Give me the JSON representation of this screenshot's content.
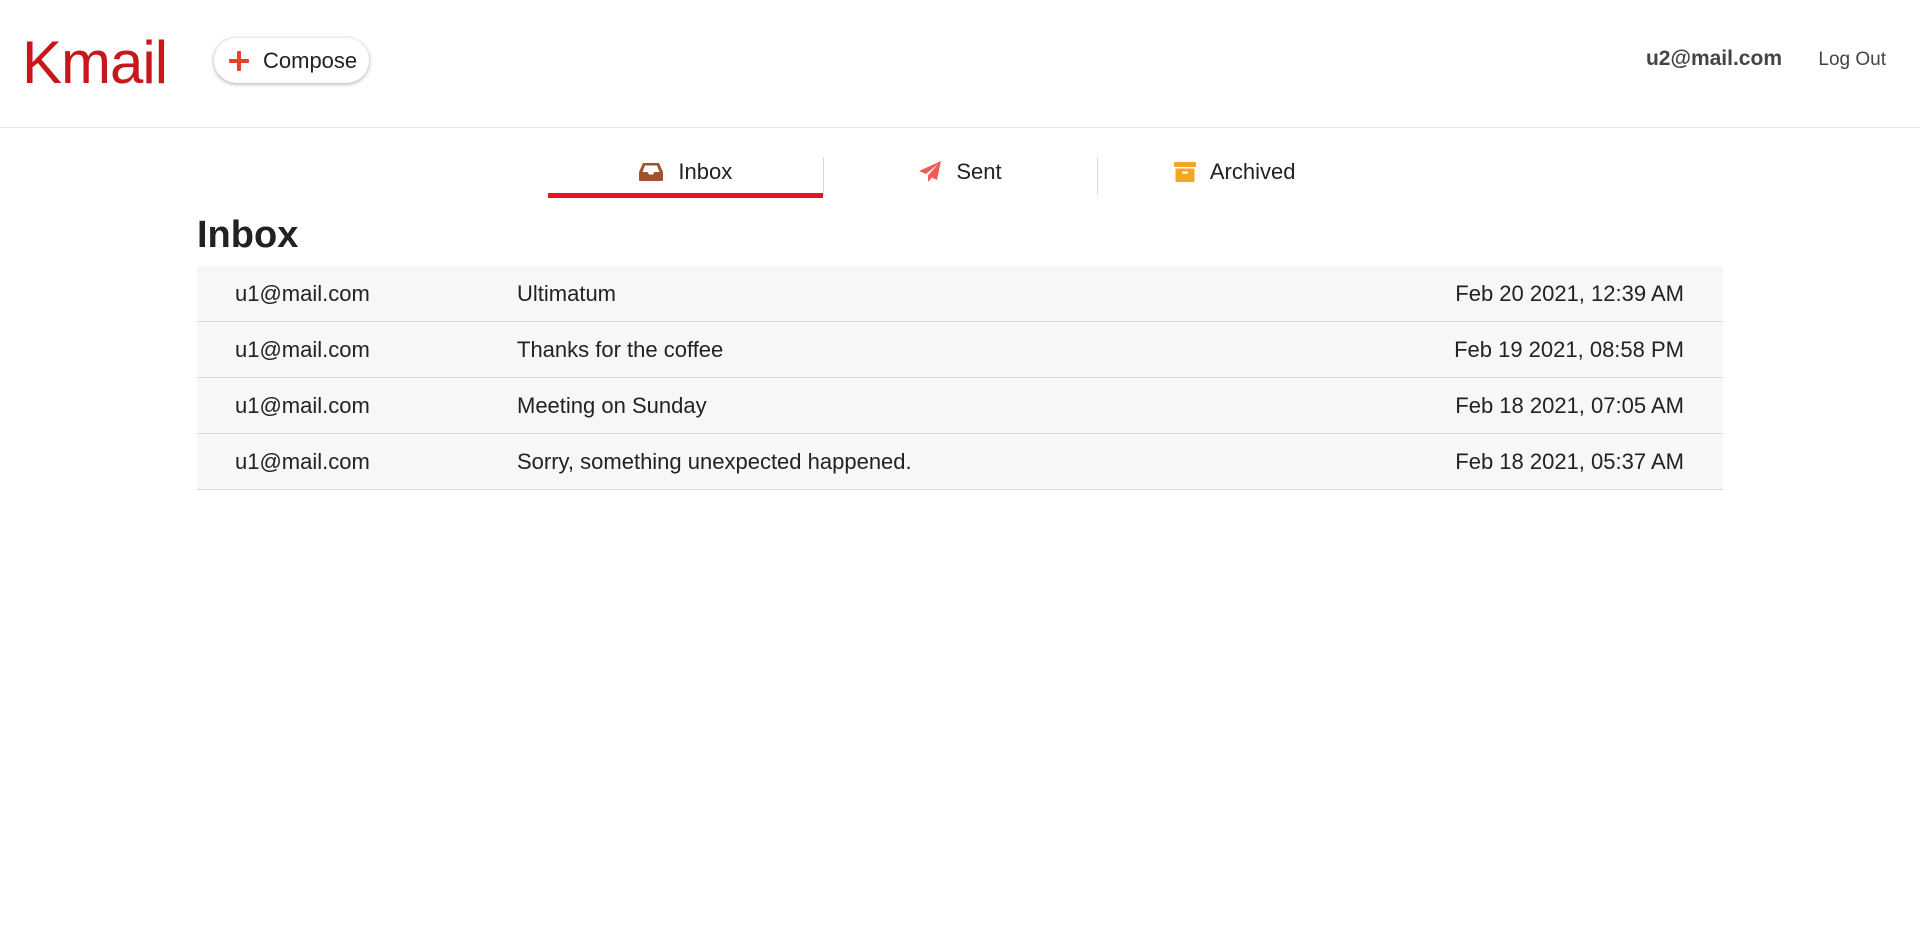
{
  "app": {
    "brand": "Kmail"
  },
  "header": {
    "compose_label": "Compose",
    "user_email": "u2@mail.com",
    "logout_label": "Log Out"
  },
  "tabs": [
    {
      "label": "Inbox",
      "icon": "inbox-icon",
      "active": true,
      "color": "#a0522d"
    },
    {
      "label": "Sent",
      "icon": "paper-plane-icon",
      "active": false,
      "color": "#f25c54"
    },
    {
      "label": "Archived",
      "icon": "archive-box-icon",
      "active": false,
      "color": "#f5a623"
    }
  ],
  "page": {
    "title": "Inbox"
  },
  "emails": [
    {
      "sender": "u1@mail.com",
      "subject": "Ultimatum",
      "date": "Feb 20 2021, 12:39 AM"
    },
    {
      "sender": "u1@mail.com",
      "subject": "Thanks for the coffee",
      "date": "Feb 19 2021, 08:58 PM"
    },
    {
      "sender": "u1@mail.com",
      "subject": "Meeting on Sunday",
      "date": "Feb 18 2021, 07:05 AM"
    },
    {
      "sender": "u1@mail.com",
      "subject": "Sorry, something unexpected happened.",
      "date": "Feb 18 2021, 05:37 AM"
    }
  ],
  "colors": {
    "brand": "#c8161d",
    "accent": "#e8141a",
    "row_background": "#f7f7f7"
  }
}
